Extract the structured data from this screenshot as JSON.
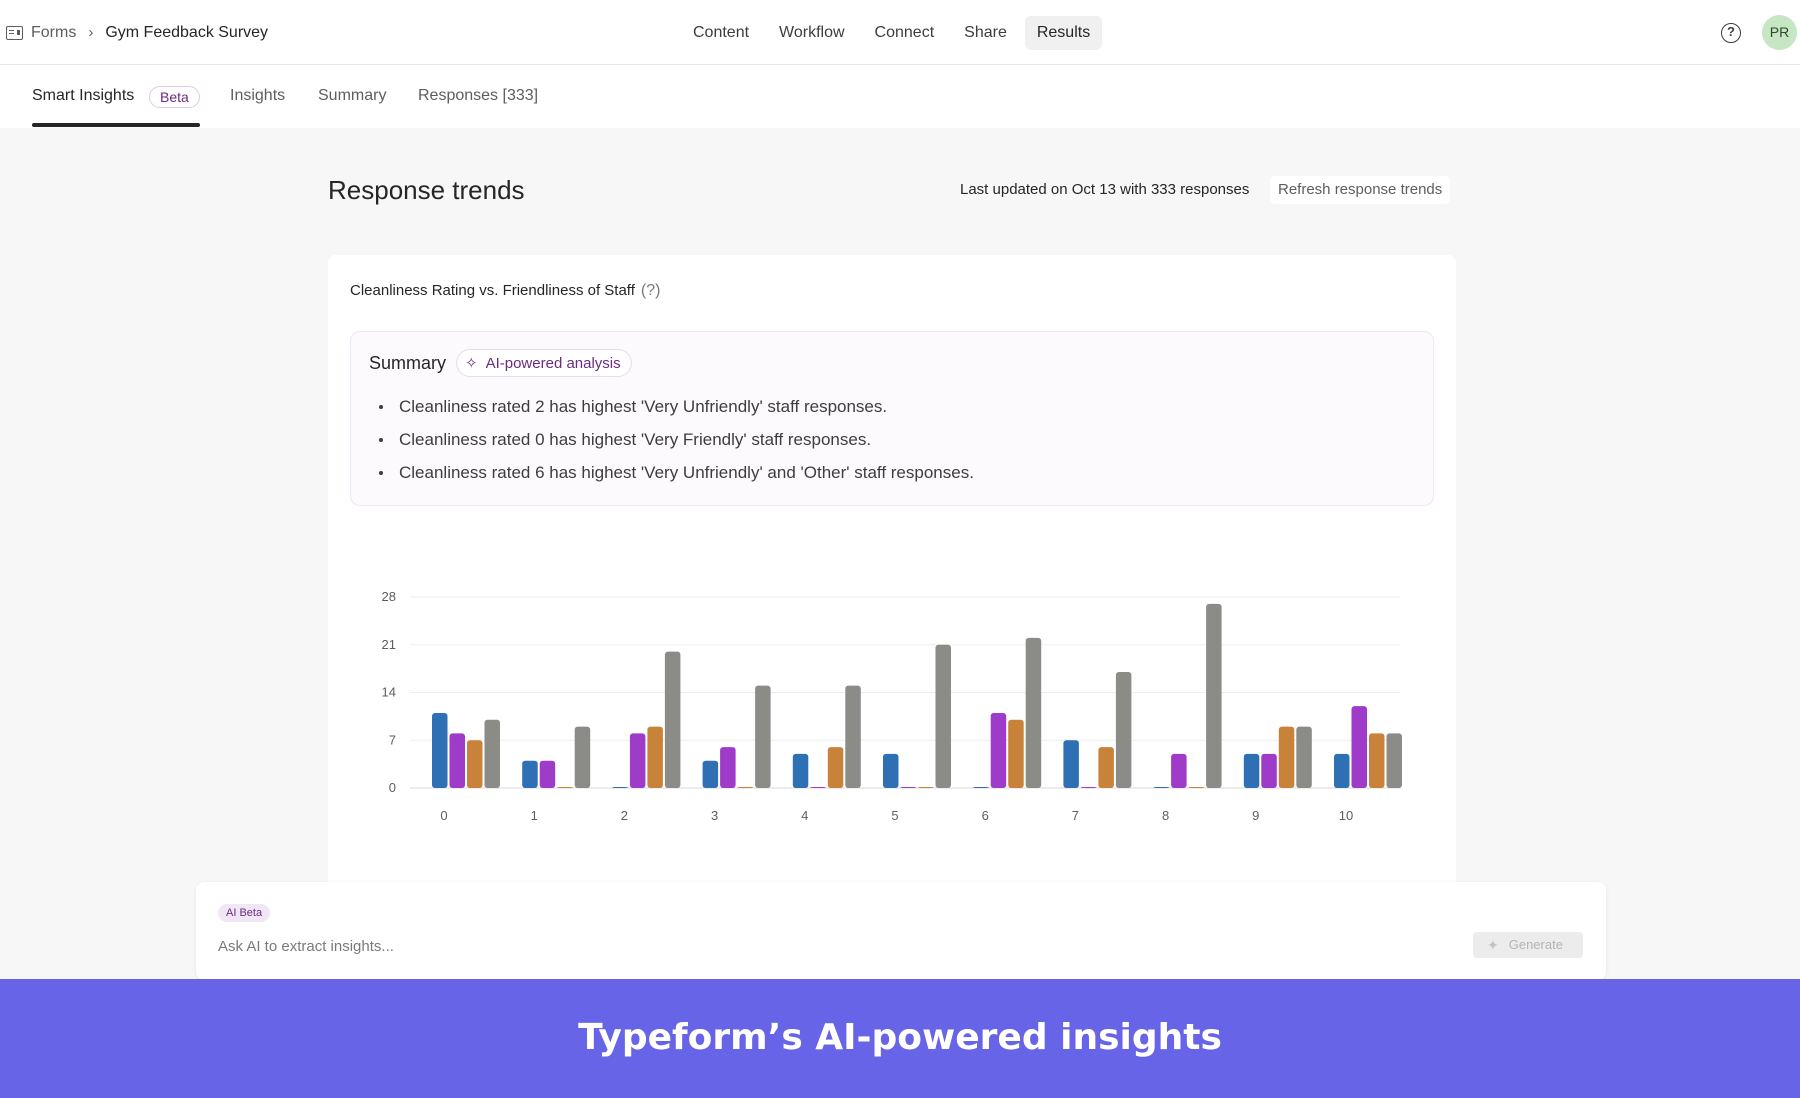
{
  "breadcrumb": {
    "root": "Forms",
    "separator": "›",
    "current": "Gym Feedback Survey"
  },
  "main_nav": [
    {
      "label": "Content",
      "active": false
    },
    {
      "label": "Workflow",
      "active": false
    },
    {
      "label": "Connect",
      "active": false
    },
    {
      "label": "Share",
      "active": false
    },
    {
      "label": "Results",
      "active": true
    }
  ],
  "header": {
    "help_icon": "?",
    "avatar_initials": "PR"
  },
  "subtabs": {
    "smart_insights": "Smart Insights",
    "beta": "Beta",
    "insights": "Insights",
    "summary": "Summary",
    "responses": "Responses [333]"
  },
  "content": {
    "title": "Response trends",
    "last_updated": "Last updated on Oct 13 with 333 responses",
    "refresh_label": "Refresh response trends"
  },
  "card": {
    "title": "Cleanliness Rating vs. Friendliness of Staff",
    "help": "(?)",
    "summary_label": "Summary",
    "ai_chip": "AI-powered analysis",
    "bullets": [
      "Cleanliness rated 2 has highest 'Very Unfriendly' staff responses.",
      "Cleanliness rated 0 has highest 'Very Friendly' staff responses.",
      "Cleanliness rated 6 has highest 'Very Unfriendly' and 'Other' staff responses."
    ]
  },
  "chart_data": {
    "type": "bar",
    "categories": [
      "0",
      "1",
      "2",
      "3",
      "4",
      "5",
      "6",
      "7",
      "8",
      "9",
      "10"
    ],
    "yticks": [
      0,
      7,
      14,
      21,
      28
    ],
    "ylim": [
      0,
      28
    ],
    "grid": true,
    "series": [
      {
        "values": [
          11,
          4,
          0,
          4,
          5,
          5,
          0,
          7,
          0,
          5,
          5
        ]
      },
      {
        "values": [
          8,
          4,
          8,
          6,
          0,
          0,
          11,
          0,
          5,
          5,
          12
        ]
      },
      {
        "values": [
          7,
          0,
          9,
          0,
          6,
          0,
          10,
          6,
          0,
          9,
          8
        ]
      },
      {
        "values": [
          10,
          9,
          20,
          15,
          15,
          21,
          22,
          17,
          27,
          9,
          8
        ]
      }
    ],
    "colors": [
      "#2f6fb4",
      "#9e3bc9",
      "#c9823a",
      "#8b8c87"
    ]
  },
  "ask_ai": {
    "badge": "AI Beta",
    "placeholder": "Ask AI to extract insights...",
    "generate_label": "Generate"
  },
  "banner": {
    "text": "Typeform’s AI-powered insights"
  }
}
